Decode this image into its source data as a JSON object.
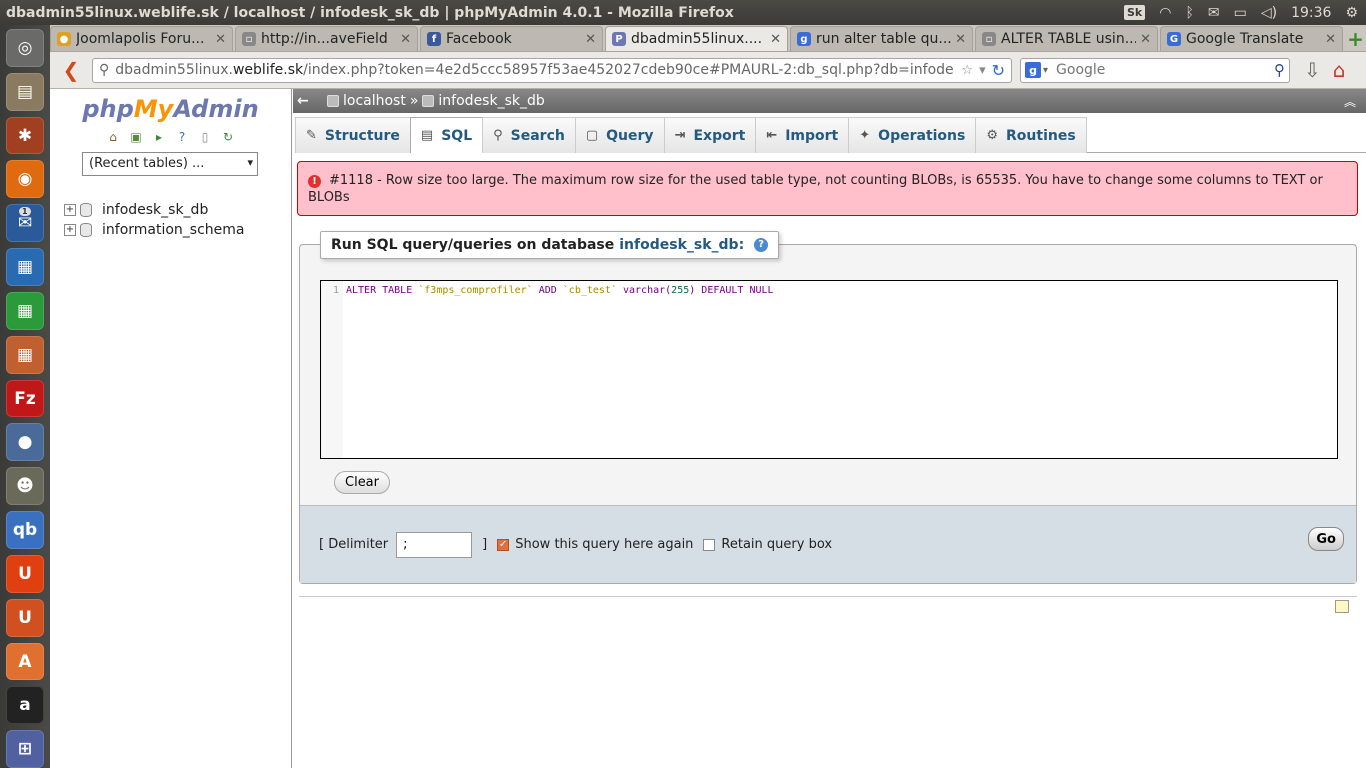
{
  "os": {
    "window_title": "dbadmin55linux.weblife.sk / localhost / infodesk_sk_db | phpMyAdmin 4.0.1 - Mozilla Firefox",
    "keyboard_layout": "Sk",
    "clock": "19:36"
  },
  "launcher": {
    "items": [
      {
        "name": "dash-home",
        "glyph": "◎",
        "color": "#6a6a68"
      },
      {
        "name": "files",
        "glyph": "▤",
        "color": "#8a7a60"
      },
      {
        "name": "system-settings",
        "glyph": "✱",
        "color": "#a04020"
      },
      {
        "name": "firefox",
        "glyph": "◉",
        "color": "#e06a10"
      },
      {
        "name": "thunderbird",
        "glyph": "✉",
        "color": "#2a5a9a",
        "badge": "1"
      },
      {
        "name": "libreoffice-writer",
        "glyph": "▦",
        "color": "#2a6ab0"
      },
      {
        "name": "libreoffice-calc",
        "glyph": "▦",
        "color": "#2a9a3a"
      },
      {
        "name": "libreoffice-impress",
        "glyph": "▦",
        "color": "#c06030"
      },
      {
        "name": "filezilla",
        "glyph": "Fz",
        "color": "#c01818"
      },
      {
        "name": "pidgin",
        "glyph": "●",
        "color": "#4a6a9a"
      },
      {
        "name": "gimp",
        "glyph": "☻",
        "color": "#6a6a5a"
      },
      {
        "name": "qbittorrent",
        "glyph": "qb",
        "color": "#3a70c0"
      },
      {
        "name": "ubuntu-one",
        "glyph": "U",
        "color": "#e04010"
      },
      {
        "name": "ubuntu-software",
        "glyph": "U",
        "color": "#d05020"
      },
      {
        "name": "software-center",
        "glyph": "A",
        "color": "#e07030"
      },
      {
        "name": "amazon",
        "glyph": "a",
        "color": "#222"
      },
      {
        "name": "workspaces",
        "glyph": "⊞",
        "color": "#5060a0"
      }
    ]
  },
  "browser": {
    "tabs": [
      {
        "label": "Joomlapolis Foru...",
        "icon_color": "#e0a020",
        "icon_glyph": "●",
        "active": false
      },
      {
        "label": "http://in...aveField",
        "icon_color": "#888",
        "icon_glyph": "▫",
        "active": false
      },
      {
        "label": "Facebook",
        "icon_color": "#3b5998",
        "icon_glyph": "f",
        "active": false
      },
      {
        "label": "dbadmin55linux....",
        "icon_color": "#6c78af",
        "icon_glyph": "P",
        "active": true
      },
      {
        "label": "run alter table qu...",
        "icon_color": "#3a6cd8",
        "icon_glyph": "g",
        "active": false
      },
      {
        "label": "ALTER TABLE usin...",
        "icon_color": "#888",
        "icon_glyph": "▫",
        "active": false
      },
      {
        "label": "Google Translate",
        "icon_color": "#3a6cd8",
        "icon_glyph": "G",
        "active": false
      }
    ],
    "url": {
      "prefix": "dbadmin55linux.",
      "domain": "weblife.sk",
      "rest": "/index.php?token=4e2d5ccc58957f53ae452027cdeb90ce#PMAURL-2:db_sql.php?db=infode"
    },
    "search_placeholder": "Google"
  },
  "pma_nav": {
    "logo": {
      "php": "php",
      "my": "My",
      "admin": "Admin"
    },
    "recent_tables": "(Recent tables) ...",
    "databases": [
      "infodesk_sk_db",
      "information_schema"
    ]
  },
  "pma_main": {
    "breadcrumb": {
      "server": "localhost",
      "separator": "»",
      "database": "infodesk_sk_db"
    },
    "tabs": [
      {
        "label": "Structure",
        "icon": "✎",
        "active": false
      },
      {
        "label": "SQL",
        "icon": "▤",
        "active": true
      },
      {
        "label": "Search",
        "icon": "⚲",
        "active": false
      },
      {
        "label": "Query",
        "icon": "▢",
        "active": false
      },
      {
        "label": "Export",
        "icon": "⇥",
        "active": false
      },
      {
        "label": "Import",
        "icon": "⇤",
        "active": false
      },
      {
        "label": "Operations",
        "icon": "✦",
        "active": false
      },
      {
        "label": "Routines",
        "icon": "⚙",
        "active": false
      }
    ],
    "error": "#1118 - Row size too large. The maximum row size for the used table type, not counting BLOBs, is 65535. You have to change some columns to TEXT or BLOBs",
    "sql_panel": {
      "legend_prefix": "Run SQL query/queries on database",
      "legend_db": "infodesk_sk_db:",
      "line_number": "1",
      "query": {
        "kw1": "ALTER TABLE",
        "tbl": "`f3mps_comprofiler`",
        "kw2": "ADD",
        "col": "`cb_test`",
        "type": "varchar(",
        "len": "255",
        "type_end": ")",
        "kw3": "DEFAULT NULL"
      },
      "clear_label": "Clear",
      "delimiter_label_open": "[ Delimiter",
      "delimiter_value": ";",
      "delimiter_label_close": "]",
      "show_again_label": "Show this query here again",
      "show_again_checked": true,
      "retain_label": "Retain query box",
      "retain_checked": false,
      "go_label": "Go"
    }
  }
}
